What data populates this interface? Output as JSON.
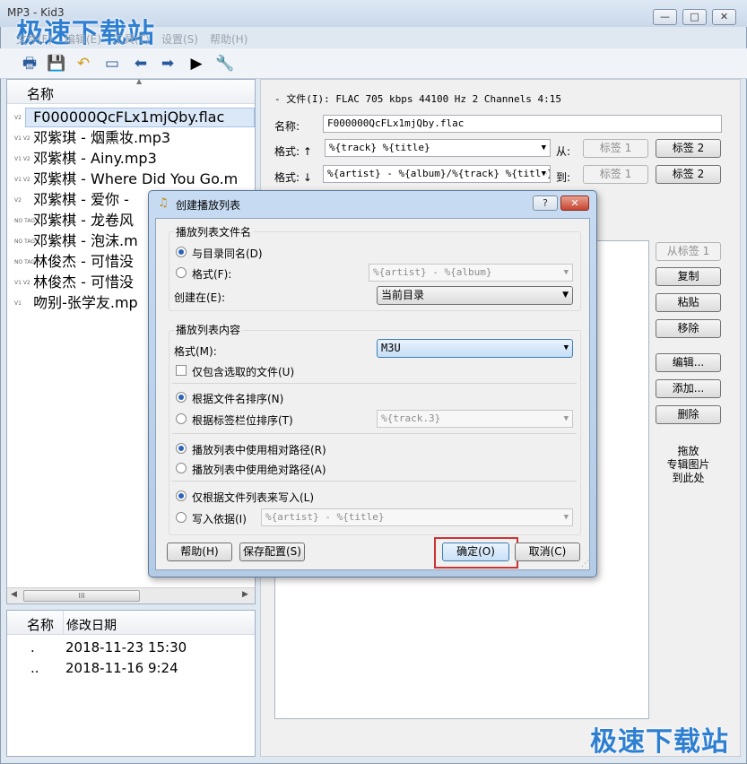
{
  "window": {
    "title": "MP3 - Kid3",
    "watermark": "极速下载站",
    "min": "—",
    "max": "□",
    "close": "✕"
  },
  "menu": [
    "文件(F)",
    "编辑(E)",
    "工具(T)",
    "设置(S)",
    "帮助(H)"
  ],
  "file_list": {
    "header": "名称",
    "items": [
      {
        "tag": "V2",
        "name": "F000000QcFLx1mjQby.flac"
      },
      {
        "tag": "V1 V2",
        "name": "邓紫琪 - 烟熏妆.mp3"
      },
      {
        "tag": "V1 V2",
        "name": "邓紫棋 - Ainy.mp3"
      },
      {
        "tag": "V1 V2",
        "name": "邓紫棋 - Where Did You Go.m"
      },
      {
        "tag": "V2",
        "name": "邓紫棋 - 爱你 -"
      },
      {
        "tag": "NO TAG",
        "name": "邓紫棋 - 龙卷风"
      },
      {
        "tag": "NO TAG",
        "name": "邓紫棋 - 泡沫.m"
      },
      {
        "tag": "NO TAG",
        "name": "林俊杰 - 可惜没"
      },
      {
        "tag": "V1 V2",
        "name": "林俊杰 - 可惜没"
      },
      {
        "tag": "V1",
        "name": "吻别-张学友.mp"
      }
    ],
    "scroll_mark": "III"
  },
  "dir_list": {
    "col_name": "名称",
    "col_date": "修改日期",
    "rows": [
      {
        "name": ".",
        "date": "2018-11-23 15:30"
      },
      {
        "name": "..",
        "date": "2018-11-16 9:24"
      }
    ]
  },
  "right": {
    "file_info": "- 文件(I): FLAC 705 kbps 44100 Hz 2 Channels 4:15",
    "name_label": "名称:",
    "name_value": "F000000QcFLx1mjQby.flac",
    "fmt_up_label": "格式: ↑",
    "fmt_up_value": "%{track} %{title}",
    "from_label": "从:",
    "fmt_down_label": "格式: ↓",
    "fmt_down_value": "%{artist} - %{album}/%{track} %{title}",
    "to_label": "到:",
    "tag1": "标签 1",
    "tag2": "标签 2",
    "from_tag1": "从标签 1",
    "copy": "复制",
    "paste": "粘贴",
    "remove": "移除",
    "edit": "编辑...",
    "add": "添加...",
    "delete": "删除",
    "drop_hint": [
      "拖放",
      "专辑图片",
      "到此处"
    ]
  },
  "dialog": {
    "title": "创建播放列表",
    "help_q": "?",
    "close": "✕",
    "group1_title": "播放列表文件名",
    "same_as_dir": "与目录同名(D)",
    "format_label": "格式(F):",
    "format_value": "%{artist} - %{album}",
    "create_in_label": "创建在(E):",
    "create_in_value": "当前目录",
    "group2_title": "播放列表内容",
    "content_format_label": "格式(M):",
    "content_format_value": "M3U",
    "only_selected": "仅包含选取的文件(U)",
    "sort_filename": "根据文件名排序(N)",
    "sort_tag": "根据标签栏位排序(T)",
    "sort_tag_value": "%{track.3}",
    "relative": "播放列表中使用相对路径(R)",
    "absolute": "播放列表中使用绝对路径(A)",
    "write_only_list": "仅根据文件列表来写入(L)",
    "write_by": "写入依据(I)",
    "write_by_value": "%{artist} - %{title}",
    "help_btn": "帮助(H)",
    "save_btn": "保存配置(S)",
    "ok_btn": "确定(O)",
    "cancel_btn": "取消(C)"
  },
  "colors": {
    "highlight": "#cc3333",
    "selected_row": "#dbe8f8"
  }
}
